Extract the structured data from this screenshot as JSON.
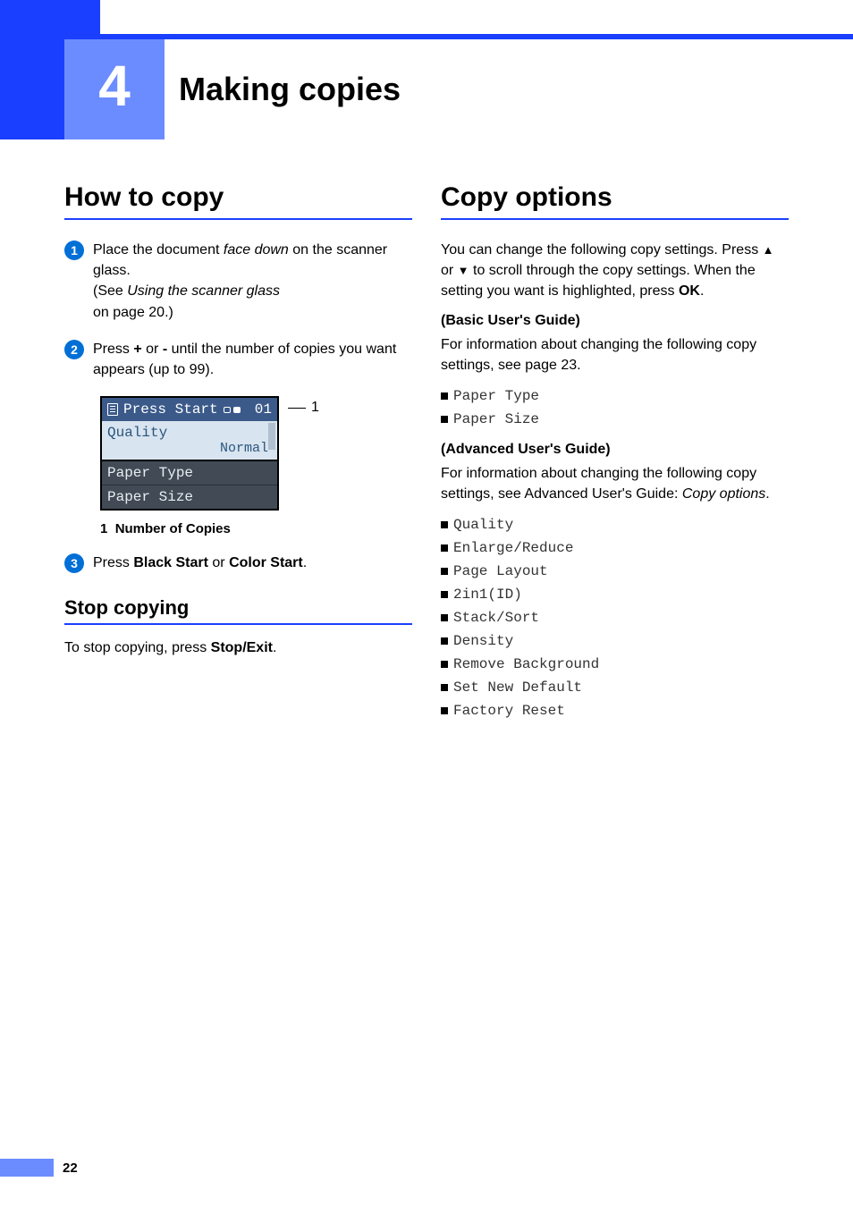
{
  "chapter": {
    "number": "4",
    "title": "Making copies"
  },
  "left": {
    "heading": "How to copy",
    "steps": {
      "s1": {
        "num": "1",
        "html": "Place the document <i>face down</i> on the scanner glass.<br>(See <i>Using the scanner glass</i><br>on page 20.)"
      },
      "s2": {
        "num": "2",
        "html": "Press <b>+</b> or <b>-</b> until the number of copies you want appears (up to 99)."
      },
      "s3": {
        "num": "3",
        "html": "Press <b>Black Start</b> or <b>Color Start</b>."
      }
    },
    "lcd": {
      "header_text": "Press Start",
      "count": "01",
      "callout": "1",
      "row_selected": "Quality",
      "row_selected_value": "Normal",
      "row2": "Paper Type",
      "row3": "Paper Size"
    },
    "legend": {
      "num": "1",
      "label": "Number of Copies"
    },
    "stop_heading": "Stop copying",
    "stop_html": "To stop copying, press <b>Stop/Exit</b>."
  },
  "right": {
    "heading": "Copy options",
    "intro_html": "You can change the following copy settings. Press <span class='upkey'>▲</span> or <span class='upkey'>▼</span> to scroll through the copy settings. When the setting you want is highlighted, press <b>OK</b>.",
    "basic_head": "(Basic User's Guide)",
    "basic_text": "For information about changing the following copy settings, see page 23.",
    "basic_items": [
      "Paper Type",
      "Paper Size"
    ],
    "adv_head": "(Advanced User's Guide)",
    "adv_html": "For information about changing the following copy settings, see Advanced User's Guide: <i>Copy options</i>.",
    "adv_items": [
      "Quality",
      "Enlarge/Reduce",
      "Page Layout",
      "2in1(ID)",
      "Stack/Sort",
      "Density",
      "Remove Background",
      "Set New Default",
      "Factory Reset"
    ]
  },
  "page_number": "22"
}
